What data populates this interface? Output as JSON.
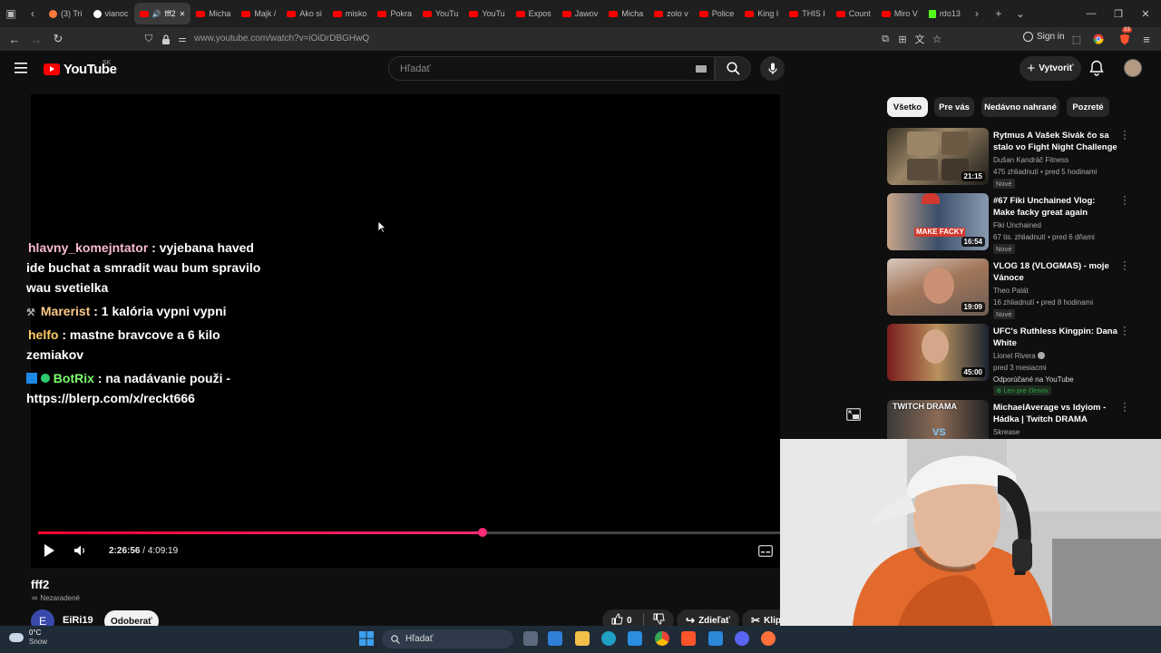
{
  "browser": {
    "tabs": [
      {
        "label": "(3) Tri",
        "fav": "o"
      },
      {
        "label": "vianoc",
        "fav": "w"
      },
      {
        "label": "fff2",
        "fav": "yt",
        "active": true
      },
      {
        "label": "Micha",
        "fav": "yt"
      },
      {
        "label": "Majk /",
        "fav": "yt"
      },
      {
        "label": "Ako si",
        "fav": "yt"
      },
      {
        "label": "misko",
        "fav": "yt"
      },
      {
        "label": "Pokra",
        "fav": "yt"
      },
      {
        "label": "YouTu",
        "fav": "yt"
      },
      {
        "label": "YouTu",
        "fav": "yt"
      },
      {
        "label": "Expos",
        "fav": "yt"
      },
      {
        "label": "Jawov",
        "fav": "yt"
      },
      {
        "label": "Micha",
        "fav": "yt"
      },
      {
        "label": "zolo v",
        "fav": "yt"
      },
      {
        "label": "Police",
        "fav": "yt"
      },
      {
        "label": "King I",
        "fav": "yt"
      },
      {
        "label": "THIS I",
        "fav": "yt"
      },
      {
        "label": "Count",
        "fav": "yt"
      },
      {
        "label": "Miro V",
        "fav": "yt"
      },
      {
        "label": "rdo13",
        "fav": "k"
      }
    ],
    "url": "www.youtube.com/watch?v=iOiDrDBGHwQ",
    "signin_label": "Sign in",
    "shield_badge": "33"
  },
  "youtube": {
    "logo_text": "YouTube",
    "region": "SK",
    "search_placeholder": "Hľadať",
    "create_label": "Vytvoriť"
  },
  "player": {
    "progress": 0.5994,
    "time_current": "2:26:56",
    "time_separator": "/",
    "time_total": "4:09:19",
    "chat": [
      {
        "user": "hlavny_komejntator",
        "user_color": "#f8bbd0",
        "text": " : vyjebana haved ide buchat a smradit wau bum spravilo wau svetielka",
        "badges": ""
      },
      {
        "user": "Marerist",
        "user_color": "#ffc987",
        "text": " : 1 kalória vypni vypni",
        "badges": "moderator"
      },
      {
        "user": "helfo",
        "user_color": "#ffcc66",
        "text": " : mastne bravcove a 6 kilo zemiakov",
        "badges": ""
      },
      {
        "user": "BotRix",
        "user_color": "#7cfc6c",
        "text": " : na nadávanie použi - https://blerp.com/x/reckt666",
        "badges": "bot-verified"
      }
    ]
  },
  "video": {
    "title": "fff2",
    "visibility": "Nezaradené",
    "channel_initial": "E",
    "channel_name": "EiRi19",
    "subscribe_label": "Odoberať",
    "like_count": "0",
    "share_label": "Zdieľať",
    "clip_label": "Klip"
  },
  "sidebar": {
    "chips": [
      "Všetko",
      "Pre vás",
      "Nedávno nahrané",
      "Pozreté"
    ],
    "recommendations": [
      {
        "title": "Rytmus A Vašek Sivák čo sa stalo vo Fight Night Challenge",
        "channel": "Dušan Kandráč Fitness",
        "meta": "475 zhliadnutí • pred 5 hodinami",
        "badge": "Nové",
        "duration": "21:15",
        "thumb_colors": [
          "#3b3326",
          "#9a8567",
          "#1c1a17"
        ],
        "verified": false,
        "extra": ""
      },
      {
        "title": "#67 Fiki Unchained Vlog: Make facky great again",
        "channel": "Fiki Unchained",
        "meta": "67 tis. zhliadnutí • pred 6 dňami",
        "badge": "Nové",
        "duration": "16:54",
        "thumb_colors": [
          "#c7a58a",
          "#3c4f6b",
          "#d23a2f"
        ],
        "verified": false,
        "extra": "",
        "thumb_text": "MAKE FACKY GREAT AGAIN"
      },
      {
        "title": "VLOG 18 (VLOGMAS) - moje Vánoce",
        "channel": "Theo Palát",
        "meta": "16 zhliadnutí • pred 8 hodinami",
        "badge": "Nové",
        "duration": "19:09",
        "thumb_colors": [
          "#d8c9c0",
          "#6c5d56",
          "#a3765a"
        ],
        "verified": false,
        "extra": ""
      },
      {
        "title": "UFC's Ruthless Kingpin: Dana White",
        "channel": "Lionel Rivera",
        "meta": "pred 3 mesiacmi",
        "badge": "",
        "duration": "45:00",
        "thumb_colors": [
          "#7a1d1d",
          "#b9925f",
          "#1b2330"
        ],
        "verified": true,
        "extra": "Odporúčané na YouTube",
        "members": "Len pre členov"
      },
      {
        "title": "MichaelAverage vs Idyiom - Hádka | Twitch DRAMA",
        "channel": "Skrease",
        "meta": "",
        "badge": "",
        "duration": "",
        "thumb_colors": [
          "#3a3a3a",
          "#8b6a55",
          "#232323"
        ],
        "verified": false,
        "extra": "",
        "thumb_text": "TWITCH DRAMA",
        "thumb_sub": "VS"
      }
    ]
  },
  "taskbar": {
    "temperature": "0°C",
    "weather": "Snow",
    "search_label": "Hľadať"
  }
}
